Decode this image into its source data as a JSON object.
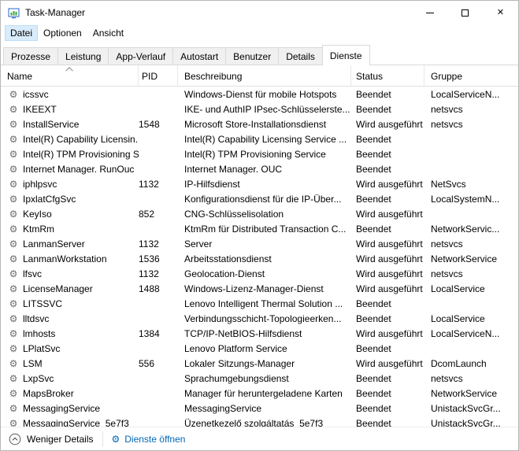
{
  "colors": {
    "link": "#0067b8"
  },
  "icons": {
    "service_gear": "⚙",
    "close": "✕"
  },
  "window": {
    "title": "Task-Manager"
  },
  "menu": {
    "items": [
      "Datei",
      "Optionen",
      "Ansicht"
    ],
    "highlighted": "Datei"
  },
  "tabs": [
    {
      "label": "Prozesse",
      "active": false
    },
    {
      "label": "Leistung",
      "active": false
    },
    {
      "label": "App-Verlauf",
      "active": false
    },
    {
      "label": "Autostart",
      "active": false
    },
    {
      "label": "Benutzer",
      "active": false
    },
    {
      "label": "Details",
      "active": false
    },
    {
      "label": "Dienste",
      "active": true
    }
  ],
  "table": {
    "columns": [
      "Name",
      "PID",
      "Beschreibung",
      "Status",
      "Gruppe"
    ],
    "sorted_by": "Name",
    "sort_direction": "ascending",
    "rows": [
      {
        "name": "icssvc",
        "pid": "",
        "description": "Windows-Dienst für mobile Hotspots",
        "status": "Beendet",
        "group": "LocalServiceN..."
      },
      {
        "name": "IKEEXT",
        "pid": "",
        "description": "IKE- und AuthIP IPsec-Schlüsselerste...",
        "status": "Beendet",
        "group": "netsvcs"
      },
      {
        "name": "InstallService",
        "pid": "1548",
        "description": "Microsoft Store-Installationsdienst",
        "status": "Wird ausgeführt",
        "group": "netsvcs"
      },
      {
        "name": "Intel(R) Capability Licensin...",
        "pid": "",
        "description": "Intel(R) Capability Licensing Service ...",
        "status": "Beendet",
        "group": ""
      },
      {
        "name": "Intel(R) TPM Provisioning S...",
        "pid": "",
        "description": "Intel(R) TPM Provisioning Service",
        "status": "Beendet",
        "group": ""
      },
      {
        "name": "Internet Manager. RunOuc",
        "pid": "",
        "description": "Internet Manager. OUC",
        "status": "Beendet",
        "group": ""
      },
      {
        "name": "iphlpsvc",
        "pid": "1132",
        "description": "IP-Hilfsdienst",
        "status": "Wird ausgeführt",
        "group": "NetSvcs"
      },
      {
        "name": "IpxlatCfgSvc",
        "pid": "",
        "description": "Konfigurationsdienst für die IP-Über...",
        "status": "Beendet",
        "group": "LocalSystemN..."
      },
      {
        "name": "KeyIso",
        "pid": "852",
        "description": "CNG-Schlüsselisolation",
        "status": "Wird ausgeführt",
        "group": ""
      },
      {
        "name": "KtmRm",
        "pid": "",
        "description": "KtmRm für Distributed Transaction C...",
        "status": "Beendet",
        "group": "NetworkServic..."
      },
      {
        "name": "LanmanServer",
        "pid": "1132",
        "description": "Server",
        "status": "Wird ausgeführt",
        "group": "netsvcs"
      },
      {
        "name": "LanmanWorkstation",
        "pid": "1536",
        "description": "Arbeitsstationsdienst",
        "status": "Wird ausgeführt",
        "group": "NetworkService"
      },
      {
        "name": "lfsvc",
        "pid": "1132",
        "description": "Geolocation-Dienst",
        "status": "Wird ausgeführt",
        "group": "netsvcs"
      },
      {
        "name": "LicenseManager",
        "pid": "1488",
        "description": "Windows-Lizenz-Manager-Dienst",
        "status": "Wird ausgeführt",
        "group": "LocalService"
      },
      {
        "name": "LITSSVC",
        "pid": "",
        "description": "Lenovo Intelligent Thermal Solution ...",
        "status": "Beendet",
        "group": ""
      },
      {
        "name": "lltdsvc",
        "pid": "",
        "description": "Verbindungsschicht-Topologieerken...",
        "status": "Beendet",
        "group": "LocalService"
      },
      {
        "name": "lmhosts",
        "pid": "1384",
        "description": "TCP/IP-NetBIOS-Hilfsdienst",
        "status": "Wird ausgeführt",
        "group": "LocalServiceN..."
      },
      {
        "name": "LPlatSvc",
        "pid": "",
        "description": "Lenovo Platform Service",
        "status": "Beendet",
        "group": ""
      },
      {
        "name": "LSM",
        "pid": "556",
        "description": "Lokaler Sitzungs-Manager",
        "status": "Wird ausgeführt",
        "group": "DcomLaunch"
      },
      {
        "name": "LxpSvc",
        "pid": "",
        "description": "Sprachumgebungsdienst",
        "status": "Beendet",
        "group": "netsvcs"
      },
      {
        "name": "MapsBroker",
        "pid": "",
        "description": "Manager für heruntergeladene Karten",
        "status": "Beendet",
        "group": "NetworkService"
      },
      {
        "name": "MessagingService",
        "pid": "",
        "description": "MessagingService",
        "status": "Beendet",
        "group": "UnistackSvcGr..."
      },
      {
        "name": "MessagingService_5e7f3",
        "pid": "",
        "description": "Üzenetkezelő szolgáltatás_5e7f3",
        "status": "Beendet",
        "group": "UnistackSvcGr..."
      }
    ]
  },
  "footer": {
    "details_toggle": "Weniger Details",
    "open_services": "Dienste öffnen"
  }
}
